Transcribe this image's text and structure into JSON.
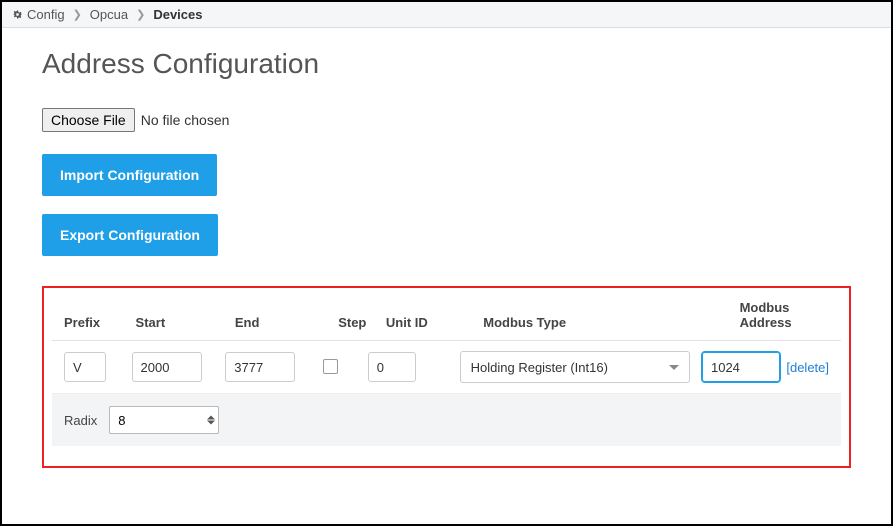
{
  "breadcrumb": {
    "items": [
      "Config",
      "Opcua"
    ],
    "current": "Devices"
  },
  "page": {
    "title": "Address Configuration"
  },
  "file": {
    "choose_label": "Choose File",
    "status": "No file chosen"
  },
  "buttons": {
    "import": "Import Configuration",
    "export": "Export Configuration"
  },
  "table": {
    "headers": {
      "prefix": "Prefix",
      "start": "Start",
      "end": "End",
      "step": "Step",
      "unit_id": "Unit ID",
      "modbus_type": "Modbus Type",
      "modbus_address": "Modbus Address"
    },
    "row": {
      "prefix": "V",
      "start": "2000",
      "end": "3777",
      "step_checked": false,
      "unit_id": "0",
      "modbus_type": "Holding Register (Int16)",
      "modbus_address": "1024",
      "delete_label": "[delete]"
    },
    "radix": {
      "label": "Radix",
      "value": "8"
    }
  }
}
